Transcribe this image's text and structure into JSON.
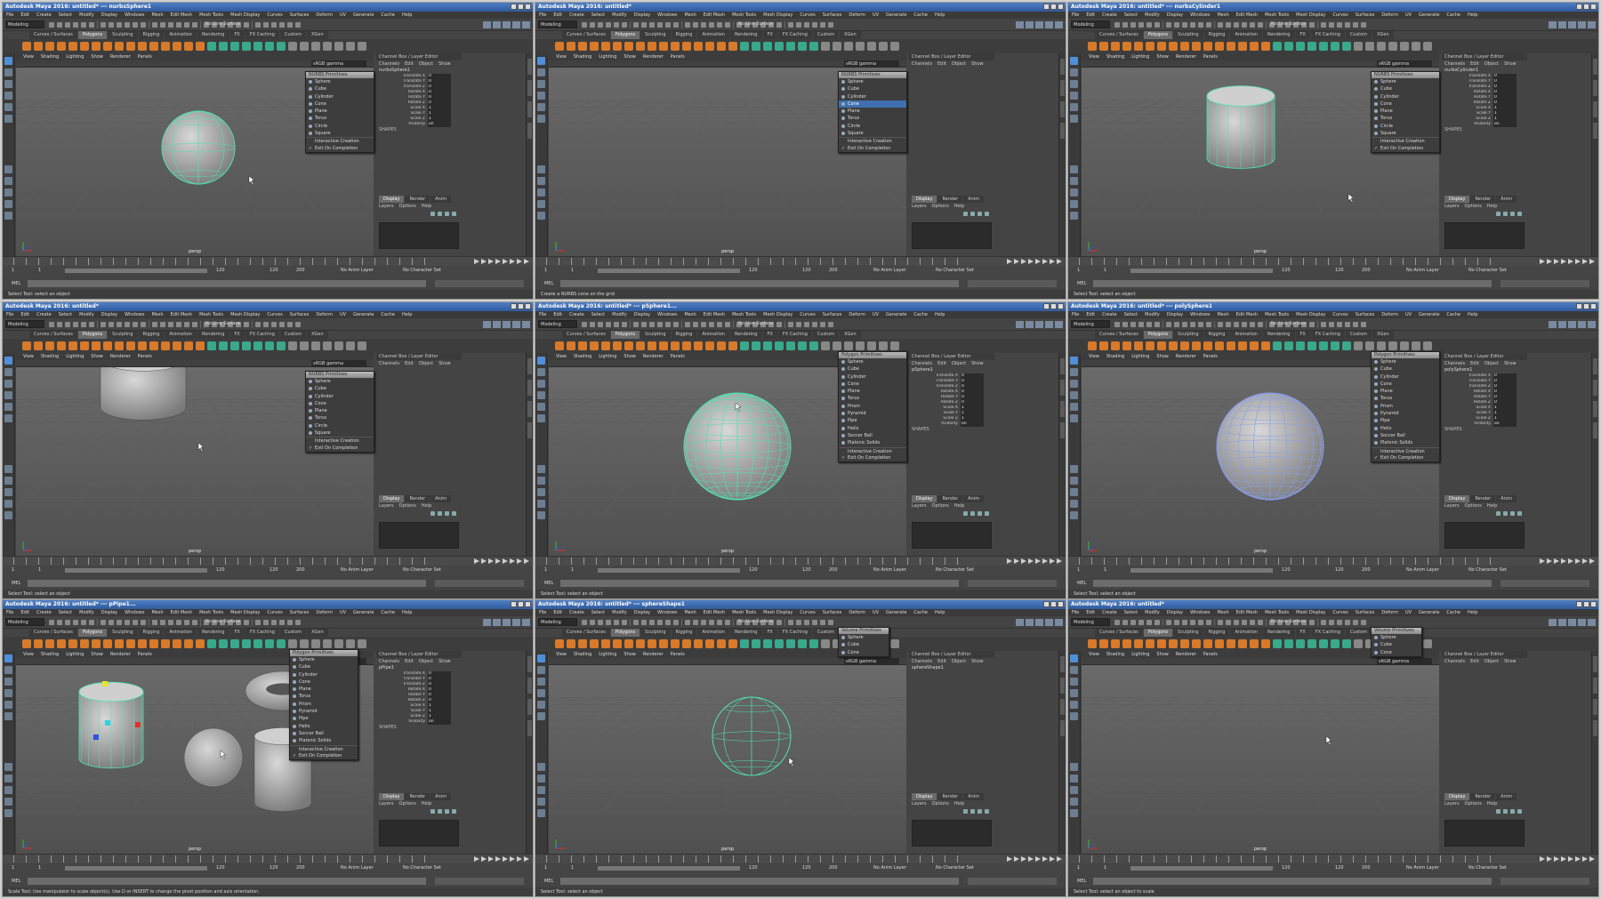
{
  "screenshot_frames": [
    {
      "title": "Autodesk Maya 2016: untitled*   ---   nurbsSphere1",
      "mode": "Modeling",
      "shelf_active": "Polygons",
      "object_name": "nurbsSphere1",
      "help": "Select Tool: select an object",
      "popup_title": "NURBS Primitives",
      "popup_items": [
        "Sphere",
        "Cube",
        "Cylinder",
        "Cone",
        "Plane",
        "Torus",
        "Circle",
        "Square",
        "Interactive Creation",
        "Exit On Completion"
      ],
      "popup_highlight": "",
      "show_attrs": true
    },
    {
      "title": "Autodesk Maya 2016: untitled*",
      "mode": "Modeling",
      "shelf_active": "Polygons",
      "object_name": "",
      "help": "Create a NURBS cone on the grid",
      "popup_title": "NURBS Primitives",
      "popup_items": [
        "Sphere",
        "Cube",
        "Cylinder",
        "Cone",
        "Plane",
        "Torus",
        "Circle",
        "Square",
        "Interactive Creation",
        "Exit On Completion"
      ],
      "popup_highlight": "Cone",
      "show_attrs": false
    },
    {
      "title": "Autodesk Maya 2016: untitled*   ---   nurbsCylinder1",
      "mode": "Modeling",
      "shelf_active": "Polygons",
      "object_name": "nurbsCylinder1",
      "help": "Select Tool: select an object",
      "popup_title": "NURBS Primitives",
      "popup_items": [
        "Sphere",
        "Cube",
        "Cylinder",
        "Cone",
        "Plane",
        "Torus",
        "Circle",
        "Square",
        "Interactive Creation",
        "Exit On Completion"
      ],
      "popup_highlight": "",
      "show_attrs": true
    },
    {
      "title": "Autodesk Maya 2016: untitled*",
      "mode": "Modeling",
      "shelf_active": "Polygons",
      "object_name": "",
      "help": "Select Tool: select an object",
      "popup_title": "NURBS Primitives",
      "popup_items": [
        "Sphere",
        "Cube",
        "Cylinder",
        "Cone",
        "Plane",
        "Torus",
        "Circle",
        "Square",
        "Interactive Creation",
        "Exit On Completion"
      ],
      "popup_highlight": "",
      "show_attrs": false
    },
    {
      "title": "Autodesk Maya 2016: untitled*   ---   pSphere1...",
      "mode": "Modeling",
      "shelf_active": "Polygons",
      "object_name": "pSphere1",
      "help": "Select Tool: select an object",
      "popup_title": "Polygon Primitives",
      "popup_items": [
        "Sphere",
        "Cube",
        "Cylinder",
        "Cone",
        "Plane",
        "Torus",
        "Prism",
        "Pyramid",
        "Pipe",
        "Helix",
        "Soccer Ball",
        "Platonic Solids",
        "Interactive Creation",
        "Exit On Completion"
      ],
      "popup_highlight": "",
      "show_attrs": true
    },
    {
      "title": "Autodesk Maya 2016: untitled*   ---   polySphere1",
      "mode": "Modeling",
      "shelf_active": "Polygons",
      "object_name": "polySphere1",
      "help": "Select Tool: select an object",
      "popup_title": "Polygon Primitives",
      "popup_items": [
        "Sphere",
        "Cube",
        "Cylinder",
        "Cone",
        "Plane",
        "Torus",
        "Prism",
        "Pyramid",
        "Pipe",
        "Helix",
        "Soccer Ball",
        "Platonic Solids",
        "Interactive Creation",
        "Exit On Completion"
      ],
      "popup_highlight": "",
      "show_attrs": true
    },
    {
      "title": "Autodesk Maya 2016: untitled*   ---   pPipe1...",
      "mode": "Modeling",
      "shelf_active": "Polygons",
      "object_name": "pPipe1",
      "help": "Scale Tool: Use manipulator to scale object(s). Use D or INSERT to change the pivot position and axis orientation.",
      "popup_title": "Polygon Primitives",
      "popup_items": [
        "Sphere",
        "Cube",
        "Cylinder",
        "Cone",
        "Plane",
        "Torus",
        "Prism",
        "Pyramid",
        "Pipe",
        "Helix",
        "Soccer Ball",
        "Platonic Solids",
        "Interactive Creation",
        "Exit On Completion"
      ],
      "popup_highlight": "",
      "show_attrs": true
    },
    {
      "title": "Autodesk Maya 2016: untitled*   ---   sphereShape1",
      "mode": "Modeling",
      "shelf_active": "Polygons",
      "object_name": "sphereShape1",
      "help": "Select Tool: select an object",
      "popup_title": "Volume Primitives",
      "popup_items": [
        "Sphere",
        "Cube",
        "Cone"
      ],
      "popup_highlight": "",
      "show_attrs": false
    },
    {
      "title": "Autodesk Maya 2016: untitled*",
      "mode": "Modeling",
      "shelf_active": "Polygons",
      "object_name": "",
      "help": "Select Tool: select an object to scale",
      "popup_title": "Volume Primitives",
      "popup_items": [
        "Sphere",
        "Cube",
        "Cone"
      ],
      "popup_highlight": "",
      "show_attrs": false
    }
  ],
  "menus": [
    "File",
    "Edit",
    "Create",
    "Select",
    "Modify",
    "Display",
    "Windows",
    "Mesh",
    "Edit Mesh",
    "Mesh Tools",
    "Mesh Display",
    "Curves",
    "Surfaces",
    "Deform",
    "UV",
    "Generate",
    "Cache",
    "Help"
  ],
  "shelf_tabs": [
    "Curves / Surfaces",
    "Polygons",
    "Sculpting",
    "Rigging",
    "Animation",
    "Rendering",
    "FX",
    "FX Caching",
    "Custom",
    "XGen"
  ],
  "viewport_menus": [
    "View",
    "Shading",
    "Lighting",
    "Show",
    "Renderer",
    "Panels"
  ],
  "gamma_label": "sRGB gamma",
  "live_surface": "No Live Surface",
  "camera_label": "persp",
  "channel_box_title": "Channel Box / Layer Editor",
  "channel_tabs": [
    "Channels",
    "Edit",
    "Object",
    "Show"
  ],
  "attr_names": [
    "Translate X",
    "Translate Y",
    "Translate Z",
    "Rotate X",
    "Rotate Y",
    "Rotate Z",
    "Scale X",
    "Scale Y",
    "Scale Z",
    "Visibility"
  ],
  "attr_values": [
    "0",
    "0",
    "0",
    "0",
    "0",
    "0",
    "1",
    "1",
    "1",
    "on"
  ],
  "shapes_label": "SHAPES",
  "layer_tabs": [
    "Display",
    "Render",
    "Anim"
  ],
  "layer_options": [
    "Layers",
    "Options",
    "Help"
  ],
  "range": {
    "start": "1",
    "end": "120",
    "anim_end": "200",
    "current": "1"
  },
  "no_anim_layer": "No Anim Layer",
  "no_char_set": "No Character Set",
  "mel_label": "MEL",
  "colors": {
    "title_bar": "#3a68b0",
    "wireframe": "#4fe3b0",
    "highlight": "#3f6fb0",
    "shelf_orange": "#d87a2a",
    "shelf_teal": "#39a98b"
  }
}
